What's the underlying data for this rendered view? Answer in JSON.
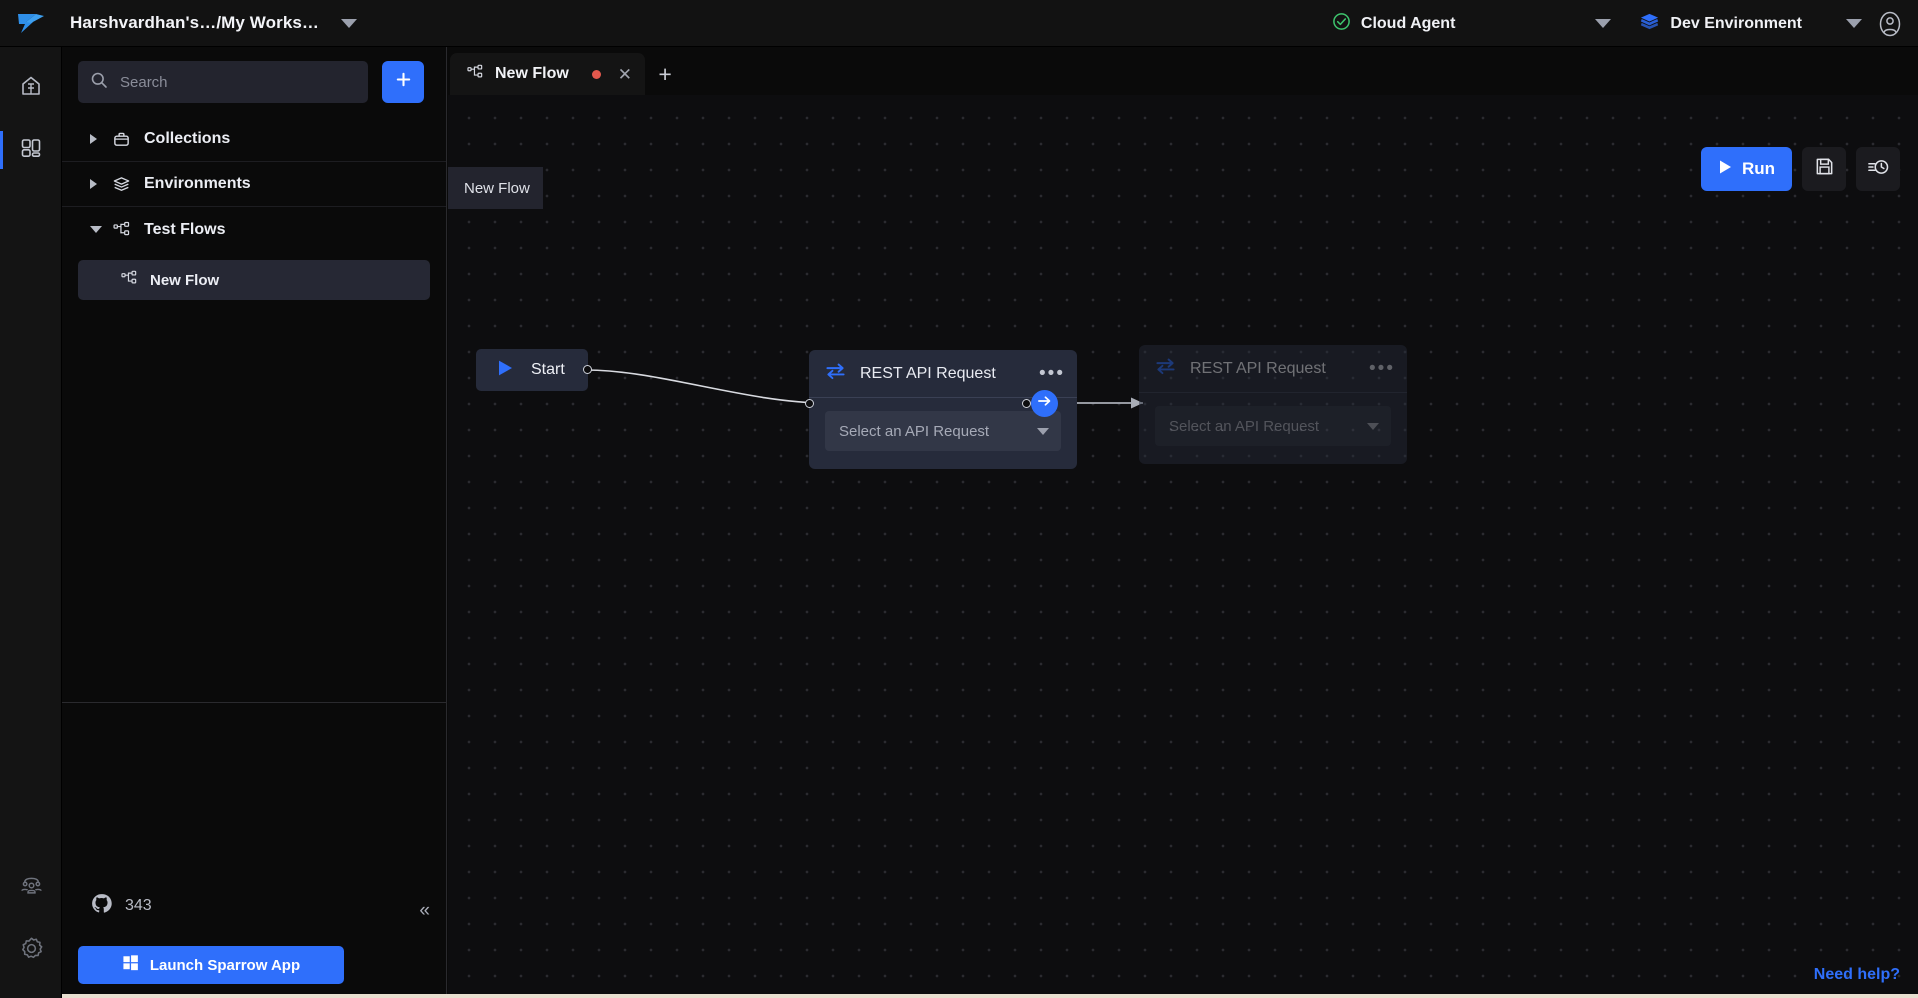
{
  "app": {
    "logo_icon": "sparrow-bird-logo",
    "workspace_title": "Harshvardhan's…/My Works…",
    "workspace_caret_icon": "chevron-down-icon"
  },
  "topbar": {
    "agent": {
      "icon": "check-circle-icon",
      "label": "Cloud Agent",
      "caret_icon": "chevron-down-icon",
      "status_color": "#3ec46d"
    },
    "environment": {
      "icon": "layers-icon",
      "label": "Dev Environment",
      "caret_icon": "chevron-down-icon",
      "accent_color": "#2f6ffb"
    },
    "account_icon": "user-avatar-icon"
  },
  "rail": {
    "items": [
      {
        "name": "home",
        "icon": "home-icon",
        "active": false
      },
      {
        "name": "workspace",
        "icon": "workspace-grid-icon",
        "active": true
      }
    ],
    "bottom_items": [
      {
        "name": "team",
        "icon": "team-people-icon"
      },
      {
        "name": "settings",
        "icon": "gear-icon"
      }
    ],
    "active_indicator_color": "#2f6ffb"
  },
  "sidebar": {
    "search": {
      "placeholder": "Search",
      "value": "",
      "icon": "search-icon"
    },
    "add_button": {
      "icon": "plus-icon",
      "label": "+"
    },
    "tree": [
      {
        "label": "Collections",
        "icon": "collection-box-icon",
        "expanded": false,
        "caret": "chevron-right-icon"
      },
      {
        "label": "Environments",
        "icon": "layers-icon",
        "expanded": false,
        "caret": "chevron-right-icon"
      },
      {
        "label": "Test Flows",
        "icon": "flow-nodes-icon",
        "expanded": true,
        "caret": "chevron-down-icon"
      }
    ],
    "flows": [
      {
        "label": "New Flow",
        "icon": "flow-nodes-icon",
        "selected": true
      }
    ],
    "github": {
      "icon": "github-icon",
      "count": "343"
    },
    "launch_button": {
      "icon": "windows-icon",
      "label": "Launch Sparrow App"
    },
    "collapse_button": {
      "icon": "chevrons-left-icon",
      "label": "«"
    }
  },
  "tabs": {
    "items": [
      {
        "label": "New Flow",
        "icon": "flow-nodes-icon",
        "active": true,
        "unsaved": true,
        "close_icon": "close-icon"
      }
    ],
    "add_tab_icon": "plus-icon",
    "add_tab_label": "+"
  },
  "canvas": {
    "flow_name": "New Flow",
    "toolbar": {
      "run": {
        "label": "Run",
        "icon": "play-icon"
      },
      "save": {
        "icon": "floppy-save-icon"
      },
      "history": {
        "icon": "clock-history-icon"
      }
    },
    "nodes": [
      {
        "id": "start",
        "type": "start",
        "label": "Start",
        "icon": "play-icon"
      },
      {
        "id": "rest-1",
        "type": "rest-api-request",
        "title": "REST API Request",
        "icon": "request-exchange-icon",
        "menu_icon": "ellipsis-icon",
        "select": {
          "label": "Select an API Request",
          "caret_icon": "chevron-down-icon"
        },
        "ghost": false
      },
      {
        "id": "rest-2",
        "type": "rest-api-request",
        "title": "REST API Request",
        "icon": "request-exchange-icon",
        "menu_icon": "ellipsis-icon",
        "select": {
          "label": "Select an API Request",
          "caret_icon": "chevron-down-icon"
        },
        "ghost": true
      }
    ],
    "add_node_button": {
      "icon": "arrow-right-circle-icon"
    },
    "need_help": "Need help?"
  }
}
